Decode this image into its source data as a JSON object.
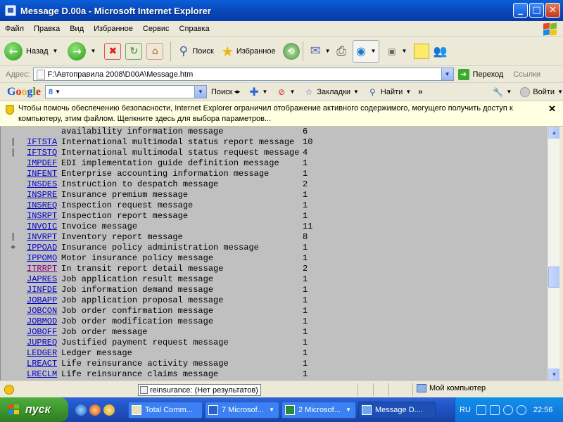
{
  "window": {
    "title": "Message D.00a - Microsoft Internet Explorer"
  },
  "menu": [
    "Файл",
    "Правка",
    "Вид",
    "Избранное",
    "Сервис",
    "Справка"
  ],
  "toolbar": {
    "back": "Назад",
    "search": "Поиск",
    "favorites": "Избранное"
  },
  "address": {
    "label": "Адрес:",
    "url": "F:\\Автоправила 2008\\D00A\\Message.htm",
    "go": "Переход",
    "links": "Ссылки"
  },
  "google": {
    "logo": "Google",
    "search": "Поиск",
    "bookmarks": "Закладки",
    "find": "Найти",
    "login": "Войти"
  },
  "infobar": {
    "text": "Чтобы помочь обеспечению безопасности, Internet Explorer ограничил отображение активного содержимого, могущего получить доступ к компьютеру, этим файлом. Щелкните здесь для выбора параметров..."
  },
  "rows": [
    {
      "mark": "",
      "code": "",
      "desc": "availability information message",
      "count": "6"
    },
    {
      "mark": "|",
      "code": "IFTSTA",
      "desc": "International multimodal status report message",
      "count": "10"
    },
    {
      "mark": "|",
      "code": "IFTSTQ",
      "desc": "International multimodal status request message",
      "count": "4"
    },
    {
      "mark": "",
      "code": "IMPDEF",
      "desc": "EDI implementation guide definition message",
      "count": "1"
    },
    {
      "mark": "",
      "code": "INFENT",
      "desc": "Enterprise accounting information message",
      "count": "1"
    },
    {
      "mark": "",
      "code": "INSDES",
      "desc": "Instruction to despatch message",
      "count": "2"
    },
    {
      "mark": "",
      "code": "INSPRE",
      "desc": "Insurance premium message",
      "count": "1"
    },
    {
      "mark": "",
      "code": "INSREQ",
      "desc": "Inspection request message",
      "count": "1"
    },
    {
      "mark": "",
      "code": "INSRPT",
      "desc": "Inspection report message",
      "count": "1"
    },
    {
      "mark": "",
      "code": "INVOIC",
      "desc": "Invoice message",
      "count": "11"
    },
    {
      "mark": "|",
      "code": "INVRPT",
      "desc": "Inventory report message",
      "count": "8"
    },
    {
      "mark": "+",
      "code": "IPPOAD",
      "desc": "Insurance policy administration message",
      "count": "1"
    },
    {
      "mark": "",
      "code": "IPPOMO",
      "desc": "Motor insurance policy message",
      "count": "1"
    },
    {
      "mark": "",
      "code": "ITRRPT",
      "desc": "In transit report detail message",
      "count": "2"
    },
    {
      "mark": "",
      "code": "JAPRES",
      "desc": "Job application result message",
      "count": "1"
    },
    {
      "mark": "",
      "code": "JINFDE",
      "desc": "Job information demand message",
      "count": "1"
    },
    {
      "mark": "",
      "code": "JOBAPP",
      "desc": "Job application proposal message",
      "count": "1"
    },
    {
      "mark": "",
      "code": "JOBCON",
      "desc": "Job order confirmation message",
      "count": "1"
    },
    {
      "mark": "",
      "code": "JOBMOD",
      "desc": "Job order modification message",
      "count": "1"
    },
    {
      "mark": "",
      "code": "JOBOFF",
      "desc": "Job order message",
      "count": "1"
    },
    {
      "mark": "",
      "code": "JUPREQ",
      "desc": "Justified payment request message",
      "count": "1"
    },
    {
      "mark": "",
      "code": "LEDGER",
      "desc": "Ledger message",
      "count": "1"
    },
    {
      "mark": "",
      "code": "LREACT",
      "desc": "Life reinsurance activity message",
      "count": "1"
    },
    {
      "mark": "",
      "code": "LRECLM",
      "desc": "Life reinsurance claims message",
      "count": "1"
    }
  ],
  "status": {
    "find": "reinsurance: (Нет результатов)",
    "zone": "Мой компьютер"
  },
  "taskbar": {
    "start": "пуск",
    "tasks": [
      "Total Comm...",
      "7 Microsof...",
      "2 Microsof...",
      "Message D...."
    ],
    "lang": "RU",
    "clock": "22:56"
  }
}
